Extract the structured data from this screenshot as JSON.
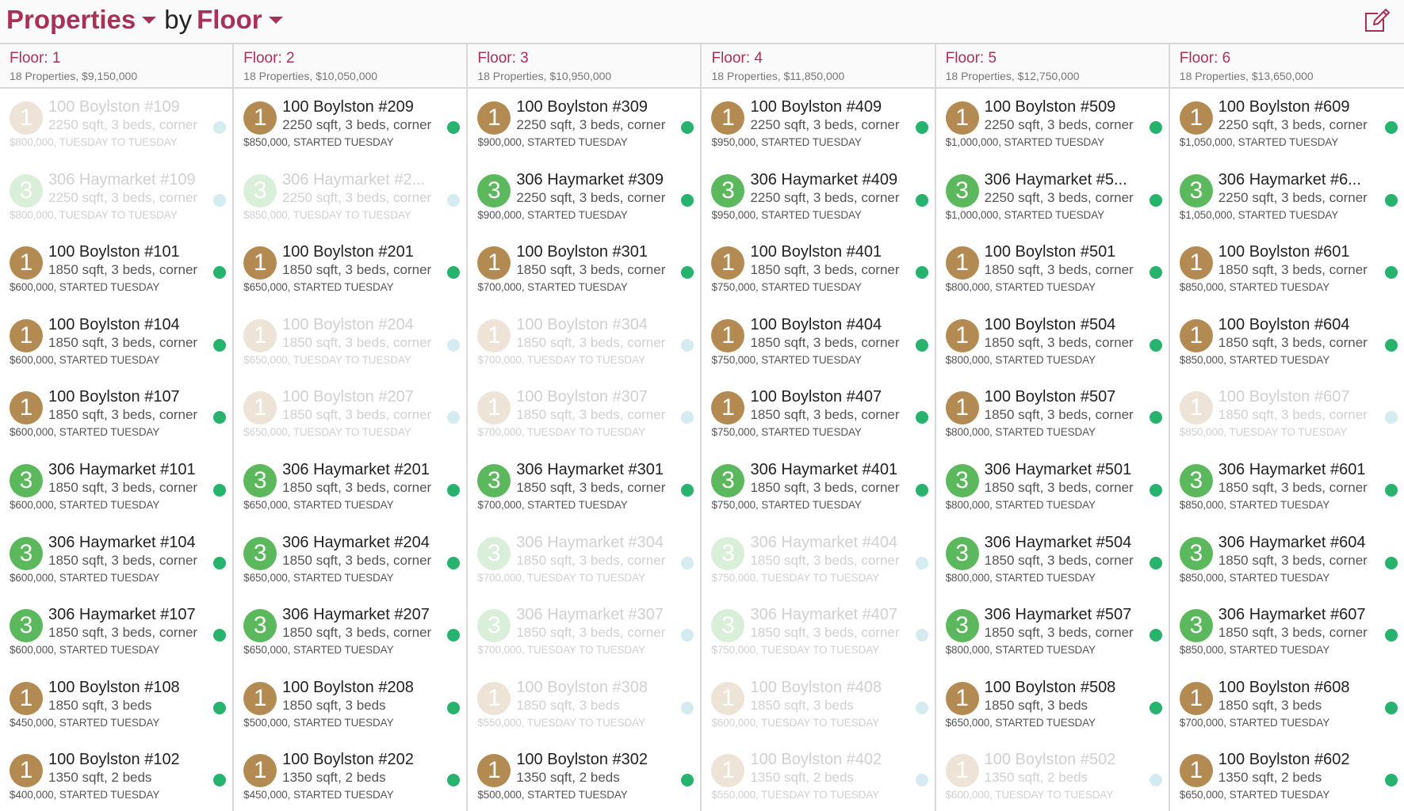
{
  "header": {
    "group_label": "Properties",
    "by_label": "by",
    "field_label": "Floor",
    "edit_icon": "edit-icon"
  },
  "colors": {
    "accent": "#a83256",
    "building_1": "#b38b52",
    "building_1_faded": "#ede3d6",
    "building_3": "#5cb85c",
    "building_3_faded": "#d9efd9",
    "status_active": "#27b36d",
    "status_pending": "#d4ecef"
  },
  "columns": [
    {
      "title": "Floor: 1",
      "summary": "18 Properties, $9,150,000",
      "cards": [
        {
          "badge": "1",
          "name": "100 Boylston #109",
          "desc": "2250 sqft, 3 beds, corner",
          "meta": "$800,000, TUESDAY TO TUESDAY",
          "faded": true
        },
        {
          "badge": "3",
          "name": "306 Haymarket #109",
          "desc": "2250 sqft, 3 beds, corner",
          "meta": "$800,000, TUESDAY TO TUESDAY",
          "faded": true
        },
        {
          "badge": "1",
          "name": "100 Boylston #101",
          "desc": "1850 sqft, 3 beds, corner",
          "meta": "$600,000, STARTED TUESDAY",
          "faded": false
        },
        {
          "badge": "1",
          "name": "100 Boylston #104",
          "desc": "1850 sqft, 3 beds, corner",
          "meta": "$600,000, STARTED TUESDAY",
          "faded": false
        },
        {
          "badge": "1",
          "name": "100 Boylston #107",
          "desc": "1850 sqft, 3 beds, corner",
          "meta": "$600,000, STARTED TUESDAY",
          "faded": false
        },
        {
          "badge": "3",
          "name": "306 Haymarket #101",
          "desc": "1850 sqft, 3 beds, corner",
          "meta": "$600,000, STARTED TUESDAY",
          "faded": false
        },
        {
          "badge": "3",
          "name": "306 Haymarket #104",
          "desc": "1850 sqft, 3 beds, corner",
          "meta": "$600,000, STARTED TUESDAY",
          "faded": false
        },
        {
          "badge": "3",
          "name": "306 Haymarket #107",
          "desc": "1850 sqft, 3 beds, corner",
          "meta": "$600,000, STARTED TUESDAY",
          "faded": false
        },
        {
          "badge": "1",
          "name": "100 Boylston #108",
          "desc": "1850 sqft, 3 beds",
          "meta": "$450,000, STARTED TUESDAY",
          "faded": false
        },
        {
          "badge": "1",
          "name": "100 Boylston #102",
          "desc": "1350 sqft, 2 beds",
          "meta": "$400,000, STARTED TUESDAY",
          "faded": false
        }
      ]
    },
    {
      "title": "Floor: 2",
      "summary": "18 Properties, $10,050,000",
      "cards": [
        {
          "badge": "1",
          "name": "100 Boylston #209",
          "desc": "2250 sqft, 3 beds, corner",
          "meta": "$850,000, STARTED TUESDAY",
          "faded": false
        },
        {
          "badge": "3",
          "name": "306 Haymarket #2...",
          "desc": "2250 sqft, 3 beds, corner",
          "meta": "$850,000, TUESDAY TO TUESDAY",
          "faded": true
        },
        {
          "badge": "1",
          "name": "100 Boylston #201",
          "desc": "1850 sqft, 3 beds, corner",
          "meta": "$650,000, STARTED TUESDAY",
          "faded": false
        },
        {
          "badge": "1",
          "name": "100 Boylston #204",
          "desc": "1850 sqft, 3 beds, corner",
          "meta": "$650,000, TUESDAY TO TUESDAY",
          "faded": true
        },
        {
          "badge": "1",
          "name": "100 Boylston #207",
          "desc": "1850 sqft, 3 beds, corner",
          "meta": "$650,000, TUESDAY TO TUESDAY",
          "faded": true
        },
        {
          "badge": "3",
          "name": "306 Haymarket #201",
          "desc": "1850 sqft, 3 beds, corner",
          "meta": "$650,000, STARTED TUESDAY",
          "faded": false
        },
        {
          "badge": "3",
          "name": "306 Haymarket #204",
          "desc": "1850 sqft, 3 beds, corner",
          "meta": "$650,000, STARTED TUESDAY",
          "faded": false
        },
        {
          "badge": "3",
          "name": "306 Haymarket #207",
          "desc": "1850 sqft, 3 beds, corner",
          "meta": "$650,000, STARTED TUESDAY",
          "faded": false
        },
        {
          "badge": "1",
          "name": "100 Boylston #208",
          "desc": "1850 sqft, 3 beds",
          "meta": "$500,000, STARTED TUESDAY",
          "faded": false
        },
        {
          "badge": "1",
          "name": "100 Boylston #202",
          "desc": "1350 sqft, 2 beds",
          "meta": "$450,000, STARTED TUESDAY",
          "faded": false
        }
      ]
    },
    {
      "title": "Floor: 3",
      "summary": "18 Properties, $10,950,000",
      "cards": [
        {
          "badge": "1",
          "name": "100 Boylston #309",
          "desc": "2250 sqft, 3 beds, corner",
          "meta": "$900,000, STARTED TUESDAY",
          "faded": false
        },
        {
          "badge": "3",
          "name": "306 Haymarket #309",
          "desc": "2250 sqft, 3 beds, corner",
          "meta": "$900,000, STARTED TUESDAY",
          "faded": false
        },
        {
          "badge": "1",
          "name": "100 Boylston #301",
          "desc": "1850 sqft, 3 beds, corner",
          "meta": "$700,000, STARTED TUESDAY",
          "faded": false
        },
        {
          "badge": "1",
          "name": "100 Boylston #304",
          "desc": "1850 sqft, 3 beds, corner",
          "meta": "$700,000, TUESDAY TO TUESDAY",
          "faded": true
        },
        {
          "badge": "1",
          "name": "100 Boylston #307",
          "desc": "1850 sqft, 3 beds, corner",
          "meta": "$700,000, TUESDAY TO TUESDAY",
          "faded": true
        },
        {
          "badge": "3",
          "name": "306 Haymarket #301",
          "desc": "1850 sqft, 3 beds, corner",
          "meta": "$700,000, STARTED TUESDAY",
          "faded": false
        },
        {
          "badge": "3",
          "name": "306 Haymarket #304",
          "desc": "1850 sqft, 3 beds, corner",
          "meta": "$700,000, TUESDAY TO TUESDAY",
          "faded": true
        },
        {
          "badge": "3",
          "name": "306 Haymarket #307",
          "desc": "1850 sqft, 3 beds, corner",
          "meta": "$700,000, TUESDAY TO TUESDAY",
          "faded": true
        },
        {
          "badge": "1",
          "name": "100 Boylston #308",
          "desc": "1850 sqft, 3 beds",
          "meta": "$550,000, TUESDAY TO TUESDAY",
          "faded": true
        },
        {
          "badge": "1",
          "name": "100 Boylston #302",
          "desc": "1350 sqft, 2 beds",
          "meta": "$500,000, STARTED TUESDAY",
          "faded": false
        }
      ]
    },
    {
      "title": "Floor: 4",
      "summary": "18 Properties, $11,850,000",
      "cards": [
        {
          "badge": "1",
          "name": "100 Boylston #409",
          "desc": "2250 sqft, 3 beds, corner",
          "meta": "$950,000, STARTED TUESDAY",
          "faded": false
        },
        {
          "badge": "3",
          "name": "306 Haymarket #409",
          "desc": "2250 sqft, 3 beds, corner",
          "meta": "$950,000, STARTED TUESDAY",
          "faded": false
        },
        {
          "badge": "1",
          "name": "100 Boylston #401",
          "desc": "1850 sqft, 3 beds, corner",
          "meta": "$750,000, STARTED TUESDAY",
          "faded": false
        },
        {
          "badge": "1",
          "name": "100 Boylston #404",
          "desc": "1850 sqft, 3 beds, corner",
          "meta": "$750,000, STARTED TUESDAY",
          "faded": false
        },
        {
          "badge": "1",
          "name": "100 Boylston #407",
          "desc": "1850 sqft, 3 beds, corner",
          "meta": "$750,000, STARTED TUESDAY",
          "faded": false
        },
        {
          "badge": "3",
          "name": "306 Haymarket #401",
          "desc": "1850 sqft, 3 beds, corner",
          "meta": "$750,000, STARTED TUESDAY",
          "faded": false
        },
        {
          "badge": "3",
          "name": "306 Haymarket #404",
          "desc": "1850 sqft, 3 beds, corner",
          "meta": "$750,000, TUESDAY TO TUESDAY",
          "faded": true
        },
        {
          "badge": "3",
          "name": "306 Haymarket #407",
          "desc": "1850 sqft, 3 beds, corner",
          "meta": "$750,000, TUESDAY TO TUESDAY",
          "faded": true
        },
        {
          "badge": "1",
          "name": "100 Boylston #408",
          "desc": "1850 sqft, 3 beds",
          "meta": "$600,000, TUESDAY TO TUESDAY",
          "faded": true
        },
        {
          "badge": "1",
          "name": "100 Boylston #402",
          "desc": "1350 sqft, 2 beds",
          "meta": "$550,000, TUESDAY TO TUESDAY",
          "faded": true
        }
      ]
    },
    {
      "title": "Floor: 5",
      "summary": "18 Properties, $12,750,000",
      "cards": [
        {
          "badge": "1",
          "name": "100 Boylston #509",
          "desc": "2250 sqft, 3 beds, corner",
          "meta": "$1,000,000, STARTED TUESDAY",
          "faded": false
        },
        {
          "badge": "3",
          "name": "306 Haymarket #5...",
          "desc": "2250 sqft, 3 beds, corner",
          "meta": "$1,000,000, STARTED TUESDAY",
          "faded": false
        },
        {
          "badge": "1",
          "name": "100 Boylston #501",
          "desc": "1850 sqft, 3 beds, corner",
          "meta": "$800,000, STARTED TUESDAY",
          "faded": false
        },
        {
          "badge": "1",
          "name": "100 Boylston #504",
          "desc": "1850 sqft, 3 beds, corner",
          "meta": "$800,000, STARTED TUESDAY",
          "faded": false
        },
        {
          "badge": "1",
          "name": "100 Boylston #507",
          "desc": "1850 sqft, 3 beds, corner",
          "meta": "$800,000, STARTED TUESDAY",
          "faded": false
        },
        {
          "badge": "3",
          "name": "306 Haymarket #501",
          "desc": "1850 sqft, 3 beds, corner",
          "meta": "$800,000, STARTED TUESDAY",
          "faded": false
        },
        {
          "badge": "3",
          "name": "306 Haymarket #504",
          "desc": "1850 sqft, 3 beds, corner",
          "meta": "$800,000, STARTED TUESDAY",
          "faded": false
        },
        {
          "badge": "3",
          "name": "306 Haymarket #507",
          "desc": "1850 sqft, 3 beds, corner",
          "meta": "$800,000, STARTED TUESDAY",
          "faded": false
        },
        {
          "badge": "1",
          "name": "100 Boylston #508",
          "desc": "1850 sqft, 3 beds",
          "meta": "$650,000, STARTED TUESDAY",
          "faded": false
        },
        {
          "badge": "1",
          "name": "100 Boylston #502",
          "desc": "1350 sqft, 2 beds",
          "meta": "$600,000, TUESDAY TO TUESDAY",
          "faded": true
        }
      ]
    },
    {
      "title": "Floor: 6",
      "summary": "18 Properties, $13,650,000",
      "cards": [
        {
          "badge": "1",
          "name": "100 Boylston #609",
          "desc": "2250 sqft, 3 beds, corner",
          "meta": "$1,050,000, STARTED TUESDAY",
          "faded": false
        },
        {
          "badge": "3",
          "name": "306 Haymarket #6...",
          "desc": "2250 sqft, 3 beds, corner",
          "meta": "$1,050,000, STARTED TUESDAY",
          "faded": false
        },
        {
          "badge": "1",
          "name": "100 Boylston #601",
          "desc": "1850 sqft, 3 beds, corner",
          "meta": "$850,000, STARTED TUESDAY",
          "faded": false
        },
        {
          "badge": "1",
          "name": "100 Boylston #604",
          "desc": "1850 sqft, 3 beds, corner",
          "meta": "$850,000, STARTED TUESDAY",
          "faded": false
        },
        {
          "badge": "1",
          "name": "100 Boylston #607",
          "desc": "1850 sqft, 3 beds, corner",
          "meta": "$850,000, TUESDAY TO TUESDAY",
          "faded": true
        },
        {
          "badge": "3",
          "name": "306 Haymarket #601",
          "desc": "1850 sqft, 3 beds, corner",
          "meta": "$850,000, STARTED TUESDAY",
          "faded": false
        },
        {
          "badge": "3",
          "name": "306 Haymarket #604",
          "desc": "1850 sqft, 3 beds, corner",
          "meta": "$850,000, STARTED TUESDAY",
          "faded": false
        },
        {
          "badge": "3",
          "name": "306 Haymarket #607",
          "desc": "1850 sqft, 3 beds, corner",
          "meta": "$850,000, STARTED TUESDAY",
          "faded": false
        },
        {
          "badge": "1",
          "name": "100 Boylston #608",
          "desc": "1850 sqft, 3 beds",
          "meta": "$700,000, STARTED TUESDAY",
          "faded": false
        },
        {
          "badge": "1",
          "name": "100 Boylston #602",
          "desc": "1350 sqft, 2 beds",
          "meta": "$650,000, STARTED TUESDAY",
          "faded": false
        }
      ]
    }
  ]
}
